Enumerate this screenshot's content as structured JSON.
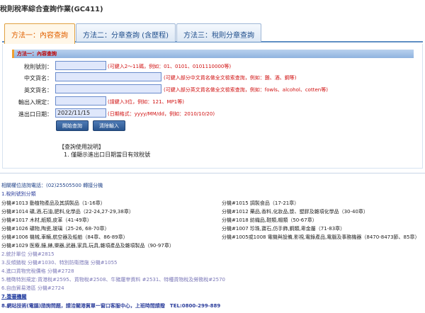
{
  "page": {
    "title": "稅則稅率綜合查詢作業(GC411)"
  },
  "tabs": [
    {
      "label": "方法一：內容查詢",
      "active": true
    },
    {
      "label": "方法二：分章查詢 (含歷程)",
      "active": false
    },
    {
      "label": "方法三：稅則分章查詢",
      "active": false
    }
  ],
  "section": {
    "title": "方法一：內容查詢"
  },
  "form": {
    "tariff_no": {
      "label": "稅則號別：",
      "value": "",
      "hint": "(可鍵入2～11碼，例如：01、0101、0101110000等)"
    },
    "cn_name": {
      "label": "中文貨名：",
      "value": "",
      "hint": "(可鍵入部分中文貨名做全文檢索查詢，例如：雞、酒、鋼等)"
    },
    "en_name": {
      "label": "英文貨名：",
      "value": "",
      "hint": "(可鍵入部分英文貨名做全文檢索查詢，例如：fowls、alcohol、cotten等)"
    },
    "rule": {
      "label": "輸出入規定：",
      "value": "",
      "hint": "(請鍵入3位，例如：121、MP1等)"
    },
    "date": {
      "label": "進出口日期：",
      "value": "2022/11/15",
      "hint": "(日期格式：yyyy/MM/dd，例如：2010/10/20)"
    }
  },
  "buttons": {
    "search": "開始查詢",
    "clear": "清除輸入"
  },
  "notes": {
    "title": "【查詢使用說明】",
    "item1": "1. 僅顯示進出口日期當日有效稅號"
  },
  "info": {
    "contact": "相關權位諮詢電話：(02)25505500 轉接分機",
    "section1": "1.稅則號別分類",
    "left_rows": [
      "分機#1013 動植物產品及其調製品（1-16章）",
      "分機#1014 礦,酒,石油,肥料,化學品（22-24,27-29,38章）",
      "分機#1017 木材,紙類,皮革（41-49章）",
      "分機#1026 礦物,陶瓷,玻璃（25-26, 68-70章）",
      "分機#1006 機械,車輛,航空器及船舶（84章、86-89章）",
      "分機#1029 医療,鐘,錶,樂器,武器,家具,玩具,雜項產品及雜項製品（90-97章）"
    ],
    "right_rows": [
      "分機#1015 調製食品（17-21章）",
      "分機#1012 藥品,香料,化妝品,漿、塑膠及雜項化學品（30-40章）",
      "分機#1018 紡織品,鞋類,帽類（50-67章）",
      "分機#1007 珍珠,寶石,仿手飾,鋼類,卑金屬（71-83章）",
      "分機#1005或1008 電機與設備,影視,電錄產品,電腦及事務機器（8470-8473節、85章）"
    ],
    "section2": "2.統計單位 分機#2815",
    "section3": "3.反傾銷稅 分機#1030、特別防衛措施 分機#1055",
    "section4": "4.進口貨物完稅價格 分機#2728",
    "section5": "5.稽徵特別規定:貨港稅#2595、貨物稅#2508、牛豬屠宰資料 #2531、特種貨物稅及勞務稅#2570",
    "section6": "6.自由貿易港區 分機#2724",
    "section7": "7.簽審機關",
    "section8": "8.網站技術(電腦)諮詢問題，請洽關港貿單一窗口客服中心，上班時間請撥　TEL:0800-299-889"
  }
}
